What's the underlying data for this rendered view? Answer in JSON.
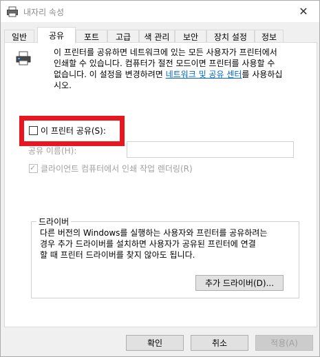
{
  "window": {
    "title": "내자리 속성",
    "close_label": "✕"
  },
  "tabs": [
    {
      "label": "일반"
    },
    {
      "label": "공유"
    },
    {
      "label": "포트"
    },
    {
      "label": "고급"
    },
    {
      "label": "색 관리"
    },
    {
      "label": "보안"
    },
    {
      "label": "장치 설정"
    },
    {
      "label": "정보"
    }
  ],
  "active_tab": "공유",
  "sharing": {
    "description_line1": "이 프린터를 공유하면 네트워크에 있는 모든 사용자가 프린터에서",
    "description_line2": "인쇄할 수 있습니다. 컴퓨터가 절전 모드이면 프린터를 사용할 수",
    "description_line3_before": "없습니다. 이 설정을 변경하려면 ",
    "description_link": "네트워크 및 공유 센터",
    "description_line3_after": "를 사용하십",
    "description_line4": "시오.",
    "share_checkbox_label": "이 프린터 공유(S):",
    "share_checked": false,
    "share_name_label": "공유 이름(H):",
    "share_name_value": "",
    "render_checkbox_label": "클라이언트 컴퓨터에서 인쇄 작업 렌더링(R)",
    "render_checked": true,
    "render_check_glyph": "✓"
  },
  "driver": {
    "title": "드라이버",
    "desc_line1": "다른 버전의 Windows를 실행하는 사용자와 프린터를 공유하려는",
    "desc_line2": "경우 추가 드라이버를 설치하면 사용자가 공유된 프린터에 연결",
    "desc_line3": "할 때 프린터 드라이버를 찾지 않아도 됩니다.",
    "add_button_label": "추가 드라이버(D)..."
  },
  "footer": {
    "ok_label": "확인",
    "cancel_label": "취소",
    "apply_label": "적용(A)"
  },
  "colors": {
    "highlight": "#e8171f",
    "link": "#0066cc"
  }
}
